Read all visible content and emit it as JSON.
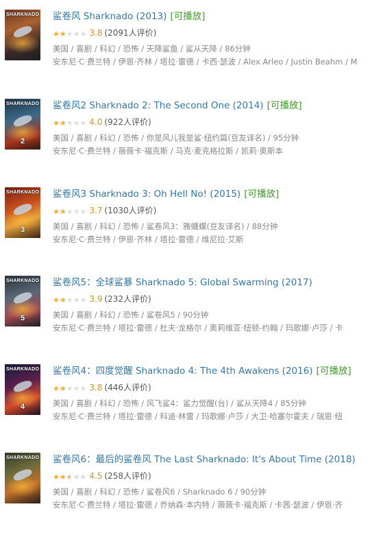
{
  "colors": {
    "title": "#3377aa",
    "playable": "#3a9d23",
    "star_on": "#ffac2d",
    "star_off": "#dddddd",
    "score": "#e09015",
    "meta": "#888888"
  },
  "movies": [
    {
      "title": "鲨卷风 Sharknado (2013)",
      "playable": "[可播放]",
      "rating_stars": 2,
      "score": "3.8",
      "votes": "(2091人评价)",
      "meta": "美国 / 喜剧 / 科幻 / 恐怖 / 天降鲨鱼 / 鲨从天降 / 86分钟",
      "cast": "安东尼·C·费兰特 / 伊恩·齐林 / 塔拉·雷德 / 卡西·瑟波 / Alex Arleo / Justin Beahm / M",
      "poster": {
        "text": "SHARKNADO",
        "num": "",
        "bg": "linear-gradient(160deg,#6d3a24 0%,#a9612f 35%,#3a2a2a 70%,#1d1d22 100%)"
      }
    },
    {
      "title": "鲨卷风2 Sharknado 2: The Second One (2014)",
      "playable": "[可播放]",
      "rating_stars": 2,
      "score": "4.0",
      "votes": "(922人评价)",
      "meta": "美国 / 喜剧 / 科幻 / 恐怖 / 你是风儿我是鲨·纽约篇(豆友译名) / 95分钟",
      "cast": "安东尼·C·费兰特 / 薇薇卡·福克斯 / 马克·麦克格拉斯 / 凯莉·奥斯本",
      "poster": {
        "text": "SHARKNADO",
        "num": "2",
        "bg": "linear-gradient(165deg,#1f3548 0%,#3c6a86 40%,#a8321e 75%,#2b1a12 100%)"
      }
    },
    {
      "title": "鲨卷风3 Sharknado 3: Oh Hell No! (2015)",
      "playable": "[可播放]",
      "rating_stars": 2,
      "score": "3.7",
      "votes": "(1030人评价)",
      "meta": "美国 / 喜剧 / 科幻 / 恐怖 / 鲨卷风3：雅蠛蝶(豆友译名) / 88分钟",
      "cast": "安东尼·C·费兰特 / 伊恩·齐林 / 塔拉·雷德 / 维尼拉·艾斯",
      "poster": {
        "text": "SHARKNADO",
        "num": "3",
        "bg": "linear-gradient(160deg,#7a1f14 0%,#c9521d 40%,#e3a23a 65%,#3b2416 100%)"
      }
    },
    {
      "title": "鲨卷风5：全球鲨暴 Sharknado 5: Global Swarming (2017)",
      "playable": "",
      "rating_stars": 2,
      "score": "3.9",
      "votes": "(232人评价)",
      "meta": "美国 / 喜剧 / 科幻 / 恐怖 / 鲨卷风5 / 90分钟",
      "cast": "安东尼·C·费兰特 / 塔拉·雷德 / 杜夫·龙格尔 / 奥莉维亚·纽顿-约翰 / 玛歌娜·卢莎 / 卡",
      "poster": {
        "text": "SHARKNADO",
        "num": "5",
        "bg": "linear-gradient(165deg,#2a3440 0%,#5b6774 40%,#a24a52 70%,#1b1f27 100%)"
      }
    },
    {
      "title": "鲨卷风4：四度觉醒 Sharknado 4: The 4th Awakens (2016)",
      "playable": "[可播放]",
      "rating_stars": 2,
      "score": "3.8",
      "votes": "(446人评价)",
      "meta": "美国 / 喜剧 / 科幻 / 恐怖 / 风飞鲨4：鲨力觉醒(台) / 鲨从天降4 / 85分钟",
      "cast": "安东尼·C·费兰特 / 塔拉·雷德 / 科迪·林雷 / 玛歌娜·卢莎 / 大卫·哈塞尔霍夫 / 瑞恩·纽",
      "poster": {
        "text": "SHARKNADO",
        "num": "4",
        "bg": "linear-gradient(160deg,#161b3b 0%,#5a1f4a 40%,#d2482a 70%,#1a1220 100%)"
      }
    },
    {
      "title": "鲨卷风6：最后的鲨卷风 The Last Sharknado: It's About Time (2018)",
      "playable": "",
      "rating_stars": 2.5,
      "score": "4.5",
      "votes": "(258人评价)",
      "meta": "美国 / 喜剧 / 科幻 / 恐怖 / 鲨卷风6 / Sharknado 6 / 90分钟",
      "cast": "安东尼·C·费兰特 / 塔拉·雷德 / 乔纳森·本内特 / 薇薇卡·福克斯 / 卡茜·瑟波 / 伊恩·齐",
      "poster": {
        "text": "SHARKNADO",
        "num": "",
        "bg": "linear-gradient(160deg,#2e3a28 0%,#6e6a3a 35%,#c0702a 65%,#2b1f18 100%)"
      }
    }
  ]
}
